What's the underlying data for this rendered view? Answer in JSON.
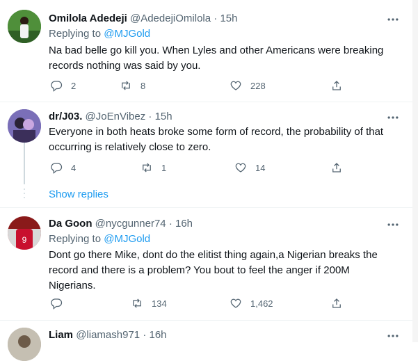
{
  "tweets": [
    {
      "name": "Omilola Adedeji",
      "handle": "@AdedejiOmilola",
      "time": "15h",
      "replying_prefix": "Replying to",
      "replying_to": "@MJGold",
      "text": "Na bad belle go kill you. When Lyles and other Americans were breaking records nothing was said by you.",
      "replies": "2",
      "retweets": "8",
      "likes": "228"
    },
    {
      "name": "dr/J03.",
      "handle": "@JoEnVibez",
      "time": "15h",
      "text": "Everyone in both heats broke some form of record, the probability of that occurring is relatively close to zero.",
      "replies": "4",
      "retweets": "1",
      "likes": "14"
    },
    {
      "name": "Da Goon",
      "handle": "@nycgunner74",
      "time": "16h",
      "replying_prefix": "Replying to",
      "replying_to": "@MJGold",
      "text": "Dont go there Mike, dont do the elitist thing again,a Nigerian breaks the record and there is a problem? You bout to feel the anger if 200M Nigerians.",
      "retweets": "134",
      "likes": "1,462"
    },
    {
      "name": "Liam",
      "handle": "@liamash971",
      "time": "16h"
    }
  ],
  "show_replies_label": "Show replies",
  "separator": "·",
  "colors": {
    "link": "#1d9bf0",
    "muted": "#536471",
    "text": "#0f1419"
  },
  "icons": [
    "reply-icon",
    "retweet-icon",
    "like-icon",
    "share-icon",
    "more-icon"
  ]
}
